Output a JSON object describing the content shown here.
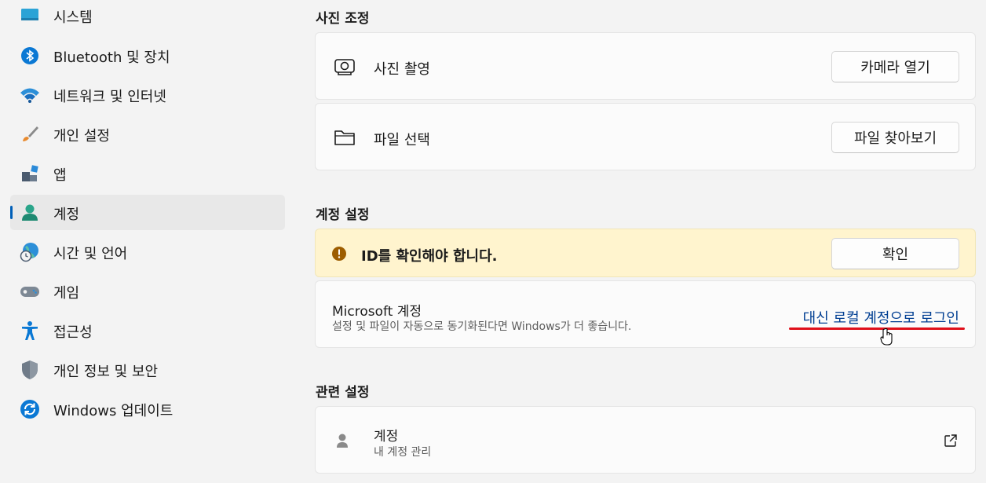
{
  "sidebar": {
    "items": [
      {
        "label": "시스템",
        "icon": "system-icon"
      },
      {
        "label": "Bluetooth 및 장치",
        "icon": "bluetooth-icon"
      },
      {
        "label": "네트워크 및 인터넷",
        "icon": "wifi-icon"
      },
      {
        "label": "개인 설정",
        "icon": "brush-icon"
      },
      {
        "label": "앱",
        "icon": "apps-icon"
      },
      {
        "label": "계정",
        "icon": "account-icon",
        "active": true
      },
      {
        "label": "시간 및 언어",
        "icon": "globe-clock-icon"
      },
      {
        "label": "게임",
        "icon": "gamepad-icon"
      },
      {
        "label": "접근성",
        "icon": "accessibility-icon"
      },
      {
        "label": "개인 정보 및 보안",
        "icon": "shield-icon"
      },
      {
        "label": "Windows 업데이트",
        "icon": "update-icon"
      }
    ]
  },
  "photo_section": {
    "title": "사진 조정",
    "take_photo": {
      "label": "사진 촬영",
      "button": "카메라 열기",
      "icon": "camera-icon"
    },
    "choose_file": {
      "label": "파일 선택",
      "button": "파일 찾아보기",
      "icon": "folder-icon"
    }
  },
  "account_section": {
    "title": "계정 설정",
    "verify": {
      "text": "ID를 확인해야 합니다.",
      "button": "확인",
      "icon": "warning-icon"
    },
    "microsoft": {
      "title": "Microsoft 계정",
      "description": "설정 및 파일이 자동으로 동기화된다면 Windows가 더 좋습니다.",
      "link": "대신 로컬 계정으로 로그인"
    }
  },
  "related_section": {
    "title": "관련 설정",
    "accounts": {
      "title": "계정",
      "subtitle": "내 계정 관리",
      "icon": "person-icon",
      "external_icon": "open-external-icon"
    }
  },
  "colors": {
    "accent": "#005fb8",
    "warning": "#fff4ce",
    "link": "#003e92",
    "highlight": "#e0101b"
  }
}
